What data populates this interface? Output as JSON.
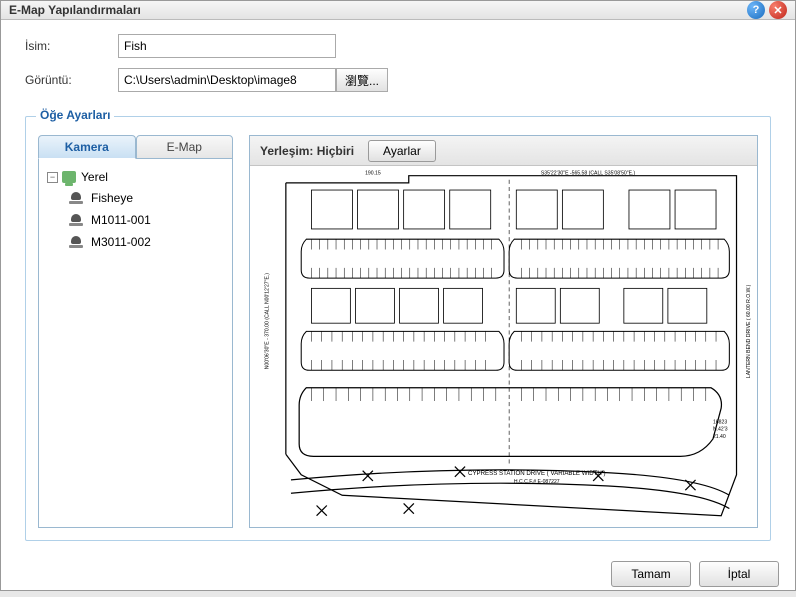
{
  "window": {
    "title": "E-Map Yapılandırmaları"
  },
  "form": {
    "name_label": "İsim:",
    "name_value": "Fish",
    "image_label": "Görüntü:",
    "image_value": "C:\\Users\\admin\\Desktop\\image8",
    "browse_label": "瀏覽..."
  },
  "fieldset": {
    "legend": "Öğe Ayarları"
  },
  "tabs": {
    "camera": "Kamera",
    "emap": "E-Map"
  },
  "tree": {
    "root": "Yerel",
    "items": [
      {
        "label": "Fisheye"
      },
      {
        "label": "M1011-001"
      },
      {
        "label": "M3011-002"
      }
    ]
  },
  "placement": {
    "label": "Yerleşim: Hiçbiri",
    "settings": "Ayarlar"
  },
  "map": {
    "top_left_dim": "190.15",
    "top_right_dim": "S35'22'30\"E -565.58 (CALL S35'08'50\"E.)",
    "left_dim": "N00'06'30\"E - 370.00 (CALL N00'12'27\"E.)",
    "bottom_road_1": "CYPRESS STATION DRIVE ( VARIABLE WIDTH )",
    "bottom_road_2": "H.C.C.F.# E-087227",
    "right_road": "LANTERN BEND DRIVE ( 60.00 R.O.W.)",
    "br_dim1": "16823",
    "br_dim2": "N.42'3",
    "br_dim3": "21.40"
  },
  "footer": {
    "ok": "Tamam",
    "cancel": "İptal"
  }
}
